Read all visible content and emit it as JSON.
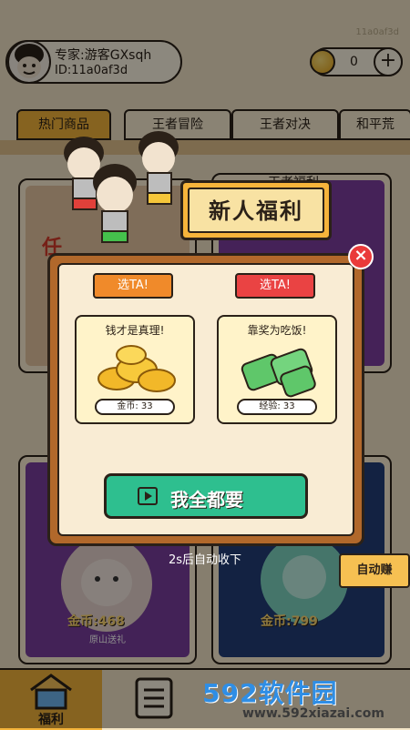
{
  "header": {
    "corner_id": "11a0af3d",
    "user_name": "专家:游客GXsqh",
    "user_id": "ID:11a0af3d",
    "coin_count": "0",
    "plus_label": "+"
  },
  "tabs": [
    {
      "label": "热门商品",
      "active": true
    },
    {
      "label": "王者冒险"
    },
    {
      "label": "王者对决"
    },
    {
      "label": "和平荒"
    }
  ],
  "cards": {
    "top_left_title": "任",
    "top_right_title": "王者福利…",
    "bottom_left_price": "金币:468",
    "bottom_left_sub": "原山送礼",
    "bottom_right_price": "金币:799"
  },
  "bottom_nav": {
    "fuli_label": "福利"
  },
  "modal": {
    "banner_title": "新人福利",
    "close_label": "×",
    "choices": [
      {
        "label": "选TA!",
        "color": "#f08a2a"
      },
      {
        "label": "选TA!",
        "color": "#ea4343"
      }
    ],
    "rewards": [
      {
        "title": "钱才是真理!",
        "tag": "金币: 33",
        "icon": "coin-pile-icon"
      },
      {
        "title": "靠奖为吃饭!",
        "tag": "经验: 33",
        "icon": "exp-cans-icon"
      }
    ],
    "all_button_label": "我全都要",
    "auto_tip": "2s后自动收下"
  },
  "side": {
    "auto_earn_label": "自动赚"
  },
  "watermark": {
    "brand": "592软件园",
    "url": "www.592xiazai.com"
  }
}
